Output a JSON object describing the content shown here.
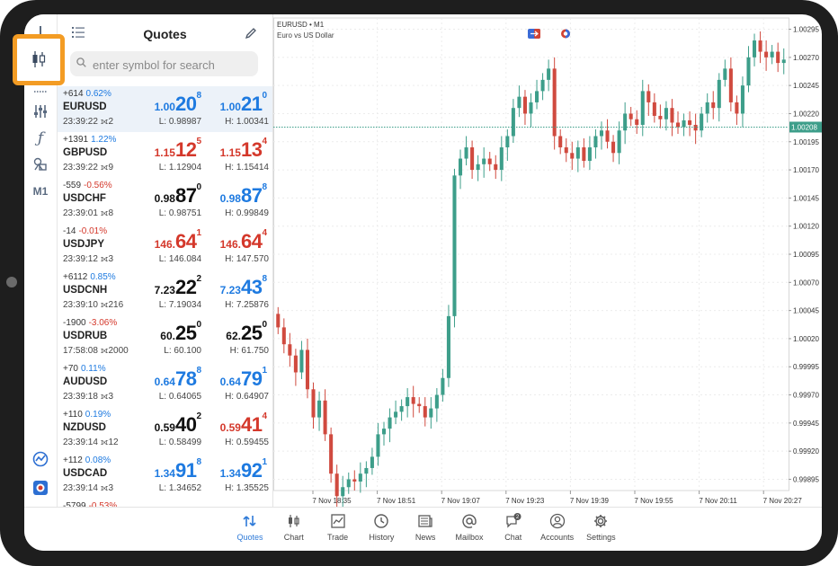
{
  "quotes_panel": {
    "title": "Quotes",
    "search_placeholder": "enter symbol for search"
  },
  "left_toolbar": {
    "timeframe": "M1"
  },
  "quotes": [
    {
      "symbol": "EURUSD",
      "change": "+614",
      "pct": "0.62%",
      "pct_color": "blue",
      "time": "23:39:22",
      "spread": "2",
      "bid": {
        "s": "1.00",
        "b": "20",
        "p": "8",
        "color": "blue"
      },
      "ask": {
        "s": "1.00",
        "b": "21",
        "p": "0",
        "color": "blue"
      },
      "low": "L: 0.98987",
      "high": "H: 1.00341",
      "selected": true
    },
    {
      "symbol": "GBPUSD",
      "change": "+1391",
      "pct": "1.22%",
      "pct_color": "blue",
      "time": "23:39:22",
      "spread": "9",
      "bid": {
        "s": "1.15",
        "b": "12",
        "p": "5",
        "color": "red"
      },
      "ask": {
        "s": "1.15",
        "b": "13",
        "p": "4",
        "color": "red"
      },
      "low": "L: 1.12904",
      "high": "H: 1.15414"
    },
    {
      "symbol": "USDCHF",
      "change": "-559",
      "pct": "-0.56%",
      "pct_color": "red",
      "time": "23:39:01",
      "spread": "8",
      "bid": {
        "s": "0.98",
        "b": "87",
        "p": "0",
        "color": "black"
      },
      "ask": {
        "s": "0.98",
        "b": "87",
        "p": "8",
        "color": "blue"
      },
      "low": "L: 0.98751",
      "high": "H: 0.99849"
    },
    {
      "symbol": "USDJPY",
      "change": "-14",
      "pct": "-0.01%",
      "pct_color": "red",
      "time": "23:39:12",
      "spread": "3",
      "bid": {
        "s": "146.",
        "b": "64",
        "p": "1",
        "color": "red"
      },
      "ask": {
        "s": "146.",
        "b": "64",
        "p": "4",
        "color": "red"
      },
      "low": "L: 146.084",
      "high": "H: 147.570"
    },
    {
      "symbol": "USDCNH",
      "change": "+6112",
      "pct": "0.85%",
      "pct_color": "blue",
      "time": "23:39:10",
      "spread": "216",
      "bid": {
        "s": "7.23",
        "b": "22",
        "p": "2",
        "color": "black"
      },
      "ask": {
        "s": "7.23",
        "b": "43",
        "p": "8",
        "color": "blue"
      },
      "low": "L: 7.19034",
      "high": "H: 7.25876"
    },
    {
      "symbol": "USDRUB",
      "change": "-1900",
      "pct": "-3.06%",
      "pct_color": "red",
      "time": "17:58:08",
      "spread": "2000",
      "bid": {
        "s": "60.",
        "b": "25",
        "p": "0",
        "color": "black"
      },
      "ask": {
        "s": "62.",
        "b": "25",
        "p": "0",
        "color": "black"
      },
      "low": "L: 60.100",
      "high": "H: 61.750"
    },
    {
      "symbol": "AUDUSD",
      "change": "+70",
      "pct": "0.11%",
      "pct_color": "blue",
      "time": "23:39:18",
      "spread": "3",
      "bid": {
        "s": "0.64",
        "b": "78",
        "p": "8",
        "color": "blue"
      },
      "ask": {
        "s": "0.64",
        "b": "79",
        "p": "1",
        "color": "blue"
      },
      "low": "L: 0.64065",
      "high": "H: 0.64907"
    },
    {
      "symbol": "NZDUSD",
      "change": "+110",
      "pct": "0.19%",
      "pct_color": "blue",
      "time": "23:39:14",
      "spread": "12",
      "bid": {
        "s": "0.59",
        "b": "40",
        "p": "2",
        "color": "black"
      },
      "ask": {
        "s": "0.59",
        "b": "41",
        "p": "4",
        "color": "red"
      },
      "low": "L: 0.58499",
      "high": "H: 0.59455"
    },
    {
      "symbol": "USDCAD",
      "change": "+112",
      "pct": "0.08%",
      "pct_color": "blue",
      "time": "23:39:14",
      "spread": "3",
      "bid": {
        "s": "1.34",
        "b": "91",
        "p": "8",
        "color": "blue"
      },
      "ask": {
        "s": "1.34",
        "b": "92",
        "p": "1",
        "color": "blue"
      },
      "low": "L: 1.34652",
      "high": "H: 1.35525"
    },
    {
      "symbol": "",
      "change": "-5799",
      "pct": "-0.53%",
      "pct_color": "red",
      "time": "",
      "spread": "",
      "bid": {
        "s": "",
        "b": "",
        "p": "",
        "color": "black"
      },
      "ask": {
        "s": "",
        "b": "",
        "p": "",
        "color": "black"
      },
      "low": "",
      "high": ""
    }
  ],
  "chart": {
    "symbol_line": "EURUSD • M1",
    "description": "Euro vs US Dollar",
    "current_price_label": "1.00208",
    "y_labels": [
      "1.00295",
      "1.00270",
      "1.00245",
      "1.00220",
      "1.00195",
      "1.00170",
      "1.00145",
      "1.00120",
      "1.00095",
      "1.00070",
      "1.00045",
      "1.00020",
      "0.99995",
      "0.99970",
      "0.99945",
      "0.99920",
      "0.99895"
    ],
    "x_labels": [
      "7 Nov 18:35",
      "7 Nov 18:51",
      "7 Nov 19:07",
      "7 Nov 19:23",
      "7 Nov 19:39",
      "7 Nov 19:55",
      "7 Nov 20:11",
      "7 Nov 20:27"
    ]
  },
  "chart_data": {
    "type": "candlestick",
    "ylim": [
      0.99885,
      1.00305
    ],
    "current_price": 1.00208,
    "up_color": "#3d9e8a",
    "down_color": "#d04a3f",
    "ohlc_closes": [
      1.0003,
      1.00015,
      1.00005,
      0.9999,
      1.0001,
      0.99975,
      0.9995,
      0.99965,
      0.99935,
      0.999,
      0.9988,
      0.99888,
      0.99895,
      0.99893,
      0.999,
      0.99905,
      0.99915,
      0.99935,
      0.9994,
      0.9995,
      0.99955,
      0.9996,
      0.99968,
      0.99962,
      0.9996,
      0.9995,
      0.99958,
      0.9997,
      0.99985,
      1.0004,
      1.00165,
      1.0018,
      1.0019,
      1.0017,
      1.00175,
      1.0018,
      1.00175,
      1.0017,
      1.0019,
      1.002,
      1.00225,
      1.00235,
      1.0022,
      1.0023,
      1.0024,
      1.0025,
      1.0026,
      1.002,
      1.0019,
      1.00185,
      1.0018,
      1.0019,
      1.00178,
      1.0019,
      1.002,
      1.00205,
      1.00195,
      1.00185,
      1.00205,
      1.0022,
      1.00215,
      1.0021,
      1.0024,
      1.0023,
      1.00218,
      1.00215,
      1.00225,
      1.00212,
      1.00208,
      1.00214,
      1.0021,
      1.00205,
      1.0022,
      1.0023,
      1.00225,
      1.0025,
      1.0026,
      1.0023,
      1.0022,
      1.00245,
      1.0027,
      1.00285,
      1.00275,
      1.0027,
      1.00275,
      1.00265,
      1.00268
    ]
  },
  "bottom_nav": [
    {
      "id": "quotes",
      "label": "Quotes",
      "icon": "quotes-icon",
      "active": true
    },
    {
      "id": "chart",
      "label": "Chart",
      "icon": "candles-icon"
    },
    {
      "id": "trade",
      "label": "Trade",
      "icon": "trade-chart-icon"
    },
    {
      "id": "history",
      "label": "History",
      "icon": "clock-icon"
    },
    {
      "id": "news",
      "label": "News",
      "icon": "newspaper-icon"
    },
    {
      "id": "mailbox",
      "label": "Mailbox",
      "icon": "at-icon"
    },
    {
      "id": "chat",
      "label": "Chat",
      "icon": "chat-bubble-icon",
      "badge": "2"
    },
    {
      "id": "accounts",
      "label": "Accounts",
      "icon": "person-circle-icon"
    },
    {
      "id": "settings",
      "label": "Settings",
      "icon": "gear-icon"
    }
  ]
}
